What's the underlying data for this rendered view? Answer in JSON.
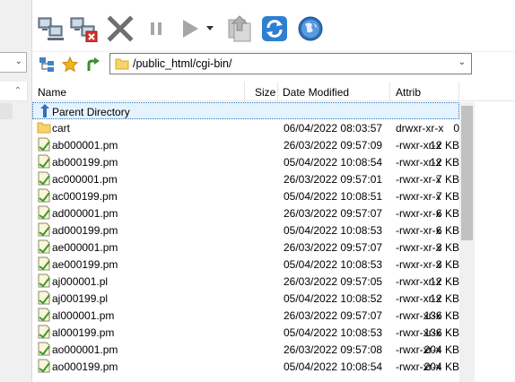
{
  "toolbar": {
    "buttons": [
      {
        "name": "connect",
        "icon": "connect-computers-icon"
      },
      {
        "name": "disconnect",
        "icon": "disconnect-computers-icon"
      },
      {
        "name": "stop",
        "icon": "stop-x-icon"
      },
      {
        "name": "pause",
        "icon": "pause-icon"
      },
      {
        "name": "play",
        "icon": "play-icon"
      },
      {
        "name": "play-dropdown",
        "icon": "dropdown-arrow-icon"
      },
      {
        "name": "queue",
        "icon": "queue-icon"
      },
      {
        "name": "refresh",
        "icon": "refresh-icon"
      },
      {
        "name": "browser",
        "icon": "globe-icon"
      }
    ]
  },
  "pathbar": {
    "path": "/public_html/cgi-bin/"
  },
  "columns": {
    "name": "Name",
    "size": "Size",
    "date": "Date Modified",
    "attrib": "Attrib"
  },
  "parent_row": {
    "name": "Parent Directory"
  },
  "files": [
    {
      "name": "cart",
      "size": "0",
      "date": "06/04/2022 08:03:57",
      "attrib": "drwxr-xr-x",
      "type": "folder"
    },
    {
      "name": "ab000001.pm",
      "size": "12 KB",
      "date": "26/03/2022 09:57:09",
      "attrib": "-rwxr-xr-x",
      "type": "file"
    },
    {
      "name": "ab000199.pm",
      "size": "12 KB",
      "date": "05/04/2022 10:08:54",
      "attrib": "-rwxr-xr-x",
      "type": "file"
    },
    {
      "name": "ac000001.pm",
      "size": "7 KB",
      "date": "26/03/2022 09:57:01",
      "attrib": "-rwxr-xr-x",
      "type": "file"
    },
    {
      "name": "ac000199.pm",
      "size": "7 KB",
      "date": "05/04/2022 10:08:51",
      "attrib": "-rwxr-xr-x",
      "type": "file"
    },
    {
      "name": "ad000001.pm",
      "size": "6 KB",
      "date": "26/03/2022 09:57:07",
      "attrib": "-rwxr-xr-x",
      "type": "file"
    },
    {
      "name": "ad000199.pm",
      "size": "6 KB",
      "date": "05/04/2022 10:08:53",
      "attrib": "-rwxr-xr-x",
      "type": "file"
    },
    {
      "name": "ae000001.pm",
      "size": "3 KB",
      "date": "26/03/2022 09:57:07",
      "attrib": "-rwxr-xr-x",
      "type": "file"
    },
    {
      "name": "ae000199.pm",
      "size": "3 KB",
      "date": "05/04/2022 10:08:53",
      "attrib": "-rwxr-xr-x",
      "type": "file"
    },
    {
      "name": "aj000001.pl",
      "size": "12 KB",
      "date": "26/03/2022 09:57:05",
      "attrib": "-rwxr-xr-x",
      "type": "file"
    },
    {
      "name": "aj000199.pl",
      "size": "12 KB",
      "date": "05/04/2022 10:08:52",
      "attrib": "-rwxr-xr-x",
      "type": "file"
    },
    {
      "name": "al000001.pm",
      "size": "136 KB",
      "date": "26/03/2022 09:57:07",
      "attrib": "-rwxr-xr-x",
      "type": "file"
    },
    {
      "name": "al000199.pm",
      "size": "136 KB",
      "date": "05/04/2022 10:08:53",
      "attrib": "-rwxr-xr-x",
      "type": "file"
    },
    {
      "name": "ao000001.pm",
      "size": "204 KB",
      "date": "26/03/2022 09:57:08",
      "attrib": "-rwxr-xr-x",
      "type": "file"
    },
    {
      "name": "ao000199.pm",
      "size": "204 KB",
      "date": "05/04/2022 10:08:54",
      "attrib": "-rwxr-xr-x",
      "type": "file"
    }
  ]
}
